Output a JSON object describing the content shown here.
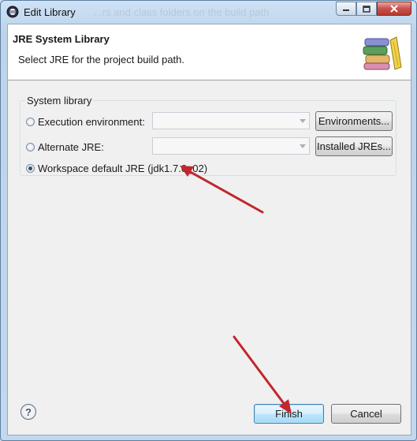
{
  "window": {
    "title": "Edit Library",
    "title_ghost": "...rs and class folders on the build path"
  },
  "header": {
    "title": "JRE System Library",
    "description": "Select JRE for the project build path."
  },
  "group": {
    "label": "System library",
    "options": [
      {
        "label": "Execution environment:",
        "selected": false,
        "combo_value": "",
        "button": "Environments..."
      },
      {
        "label": "Alternate JRE:",
        "selected": false,
        "combo_value": "",
        "button": "Installed JREs..."
      },
      {
        "label": "Workspace default JRE (jdk1.7.0_02)",
        "selected": true
      }
    ]
  },
  "footer": {
    "help_glyph": "?",
    "finish_label": "Finish",
    "cancel_label": "Cancel"
  },
  "colors": {
    "annotation_arrow": "#c0272d",
    "default_button_border": "#3c7fb1"
  }
}
